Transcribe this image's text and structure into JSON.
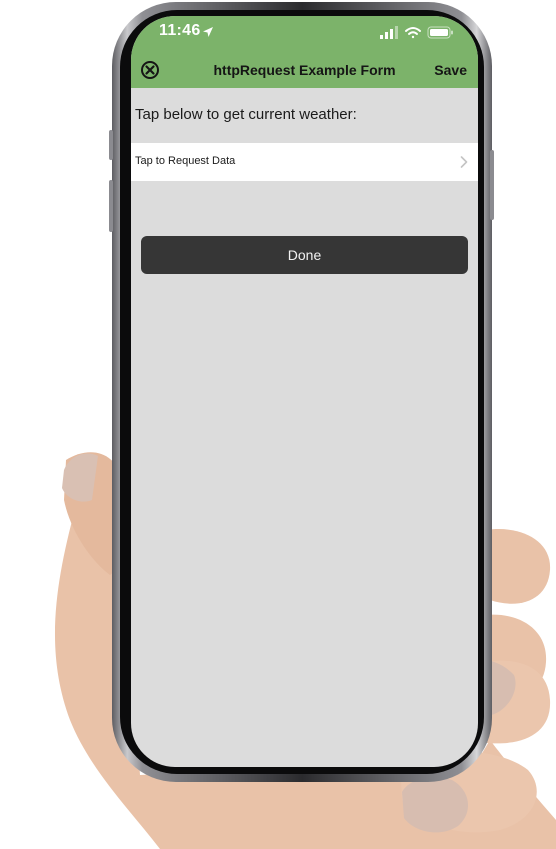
{
  "status_bar": {
    "time": "11:46",
    "icons": [
      "location-arrow-icon",
      "cellular-signal-icon",
      "wifi-icon",
      "battery-icon"
    ]
  },
  "nav": {
    "close_icon": "close-circle-icon",
    "title": "httpRequest Example Form",
    "save_label": "Save"
  },
  "form": {
    "prompt": "Tap below to get current weather:",
    "request_row_label": "Tap to Request Data",
    "request_row_icon": "chevron-right-icon",
    "done_label": "Done"
  },
  "colors": {
    "nav_green": "#7cb36a",
    "screen_bg": "#dcdcdc",
    "done_button": "#363636",
    "row_bg": "#ffffff"
  }
}
